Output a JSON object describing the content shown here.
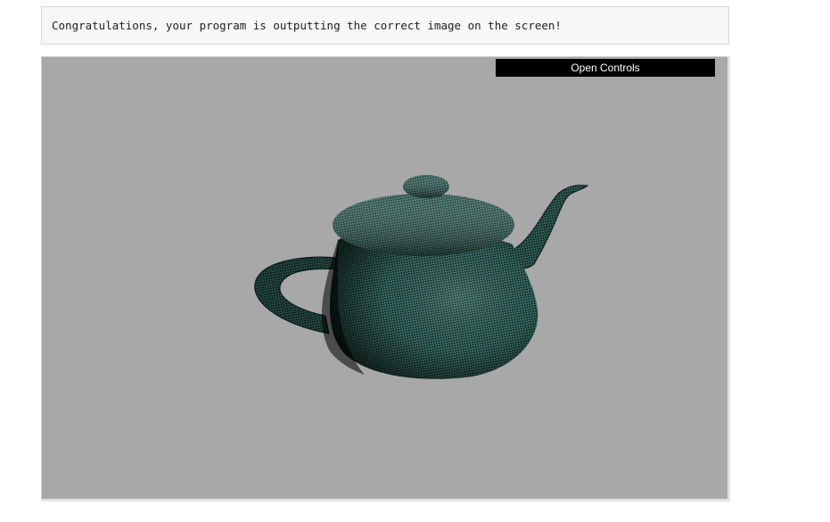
{
  "message": {
    "text": "Congratulations, your program is outputting the correct image on the screen!"
  },
  "controls": {
    "label": "Open Controls"
  },
  "colors": {
    "canvas_background": "#a8a8a8",
    "teapot_dark": "#0d201c",
    "teapot_light": "#3f7a70"
  }
}
